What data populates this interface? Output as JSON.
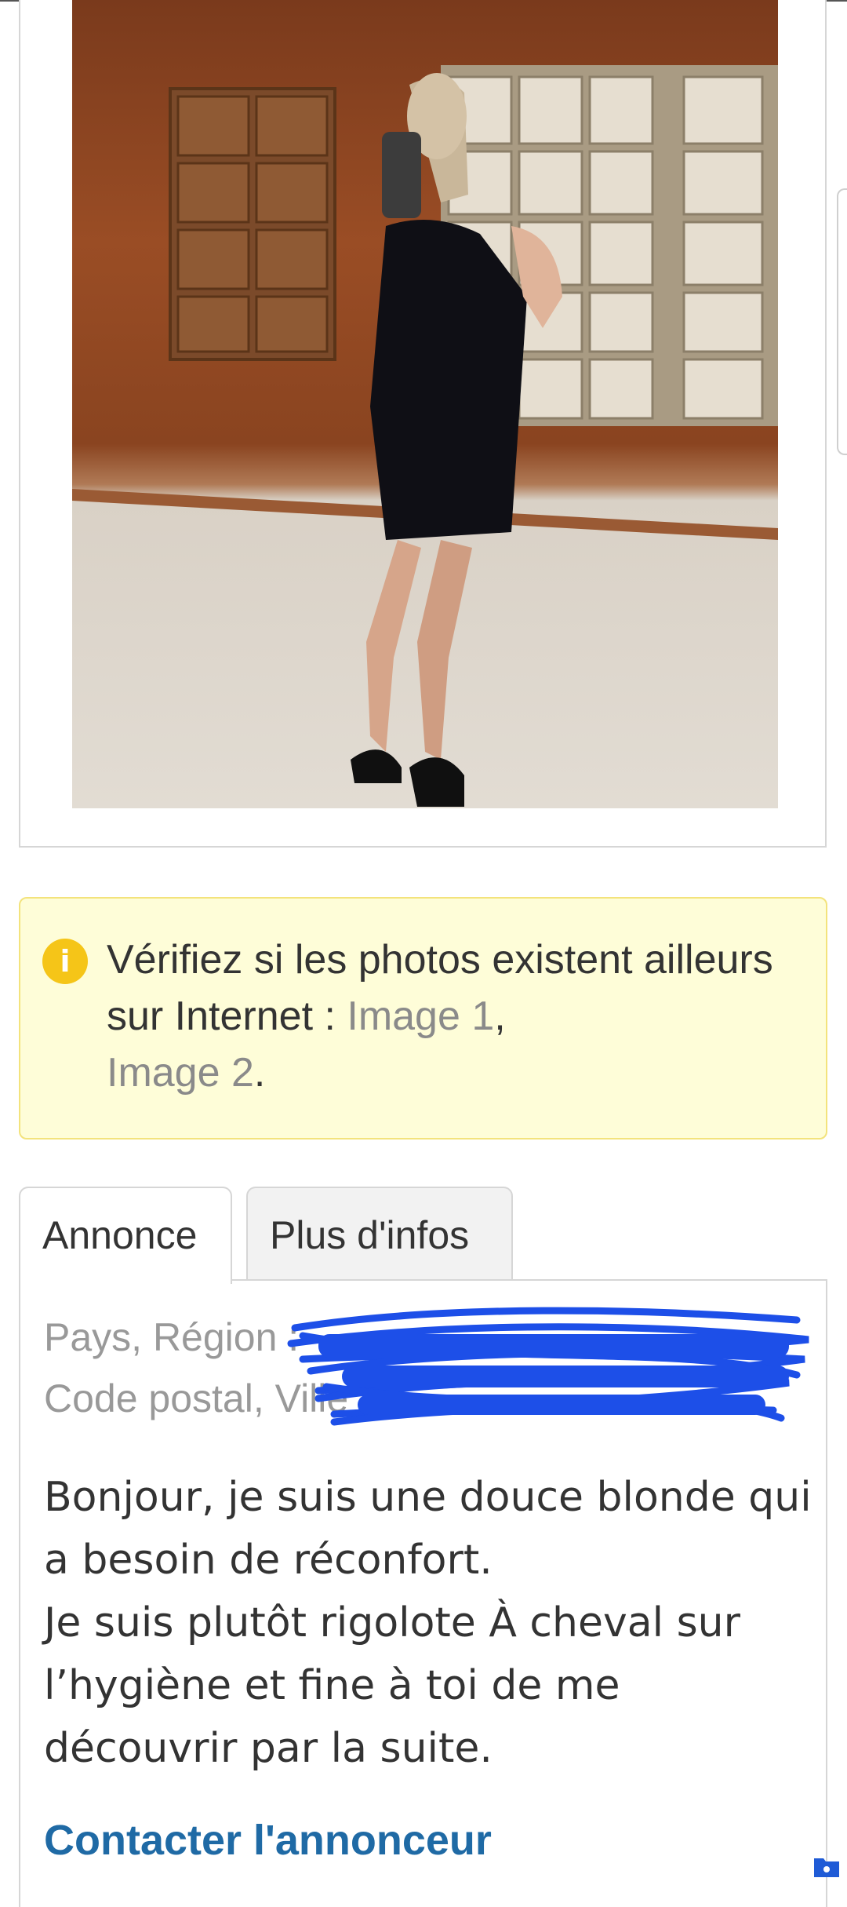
{
  "photo": {
    "alt": "photo"
  },
  "info": {
    "text": "Vérifiez si les photos existent ailleurs sur Internet : ",
    "link1": "Image 1",
    "sep": ",",
    "link2": "Image 2",
    "end": "."
  },
  "tabs": [
    {
      "label": "Annonce",
      "active": true
    },
    {
      "label": "Plus d'infos",
      "active": false
    }
  ],
  "meta": {
    "line1": "Pays, Région :",
    "line2": "Code postal, Ville"
  },
  "description": "Bonjour, je suis une douce blonde qui a besoin de réconfort.\nJe suis plutôt rigolote À cheval sur l’hygiène et fine à toi de me découvrir par la suite.",
  "contact_label": "Contacter l'annonceur",
  "colors": {
    "accent": "#1f6aa5",
    "info_bg": "#fefdd8",
    "info_border": "#f3e37c",
    "redaction": "#1d4fe8"
  }
}
